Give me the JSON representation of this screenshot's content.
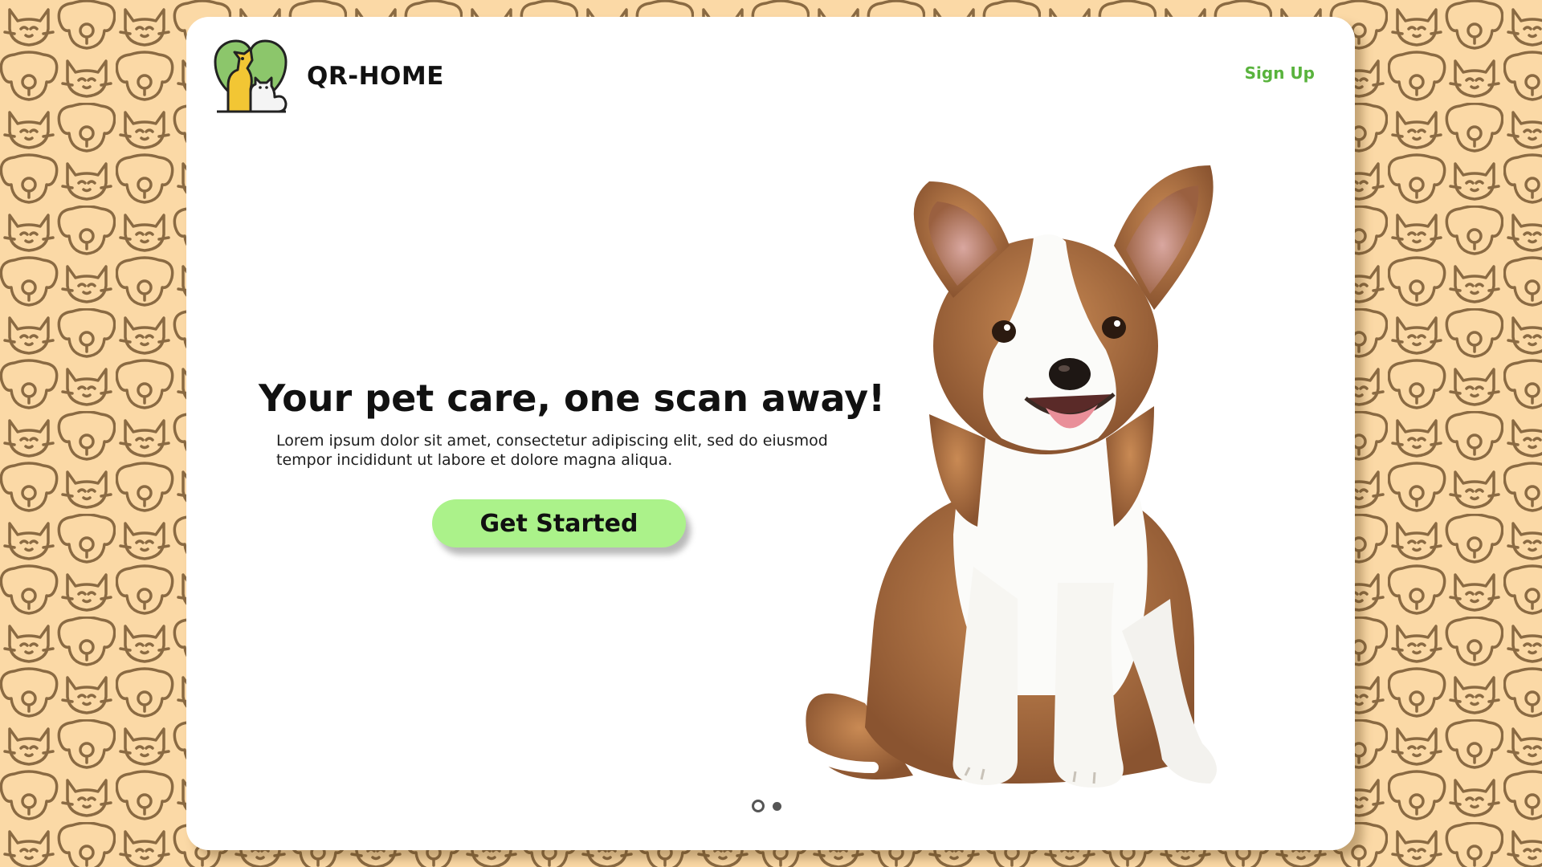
{
  "brand": {
    "name": "QR-HOME",
    "logo_icon": "pets-heart-logo-icon"
  },
  "nav": {
    "signup_label": "Sign Up"
  },
  "hero": {
    "title": "Your pet care, one scan away!",
    "description": "Lorem ipsum dolor sit amet, consectetur adipiscing elit, sed do eiusmod tempor incididunt ut labore et dolore magna aliqua.",
    "cta_label": "Get Started",
    "image": "puppy-photo"
  },
  "carousel": {
    "total_slides": 2,
    "active_slide": 1
  },
  "colors": {
    "background": "#fbd9a6",
    "pattern": "#8a6a42",
    "accent": "#59b33d",
    "cta": "#abf28a",
    "card": "#ffffff"
  }
}
